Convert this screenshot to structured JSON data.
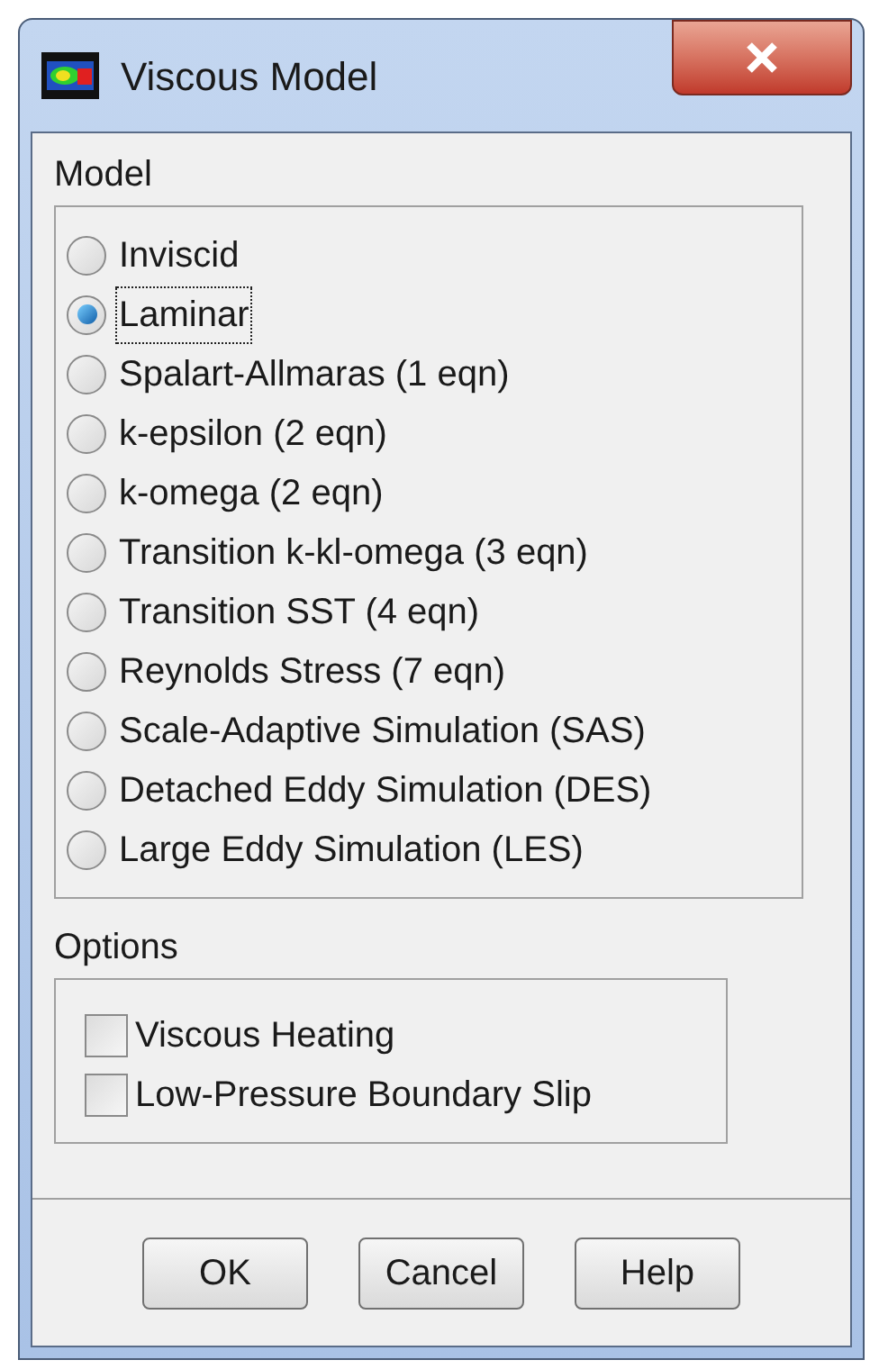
{
  "window": {
    "title": "Viscous Model"
  },
  "model": {
    "label": "Model",
    "options": [
      {
        "label": "Inviscid",
        "selected": false
      },
      {
        "label": "Laminar",
        "selected": true
      },
      {
        "label": "Spalart-Allmaras (1 eqn)",
        "selected": false
      },
      {
        "label": "k-epsilon (2 eqn)",
        "selected": false
      },
      {
        "label": "k-omega (2 eqn)",
        "selected": false
      },
      {
        "label": "Transition k-kl-omega (3 eqn)",
        "selected": false
      },
      {
        "label": "Transition SST (4 eqn)",
        "selected": false
      },
      {
        "label": "Reynolds Stress (7 eqn)",
        "selected": false
      },
      {
        "label": "Scale-Adaptive Simulation (SAS)",
        "selected": false
      },
      {
        "label": "Detached Eddy Simulation (DES)",
        "selected": false
      },
      {
        "label": "Large Eddy Simulation (LES)",
        "selected": false
      }
    ]
  },
  "options": {
    "label": "Options",
    "items": [
      {
        "label": "Viscous Heating",
        "checked": false
      },
      {
        "label": "Low-Pressure Boundary Slip",
        "checked": false
      }
    ]
  },
  "buttons": [
    "OK",
    "Cancel",
    "Help"
  ]
}
